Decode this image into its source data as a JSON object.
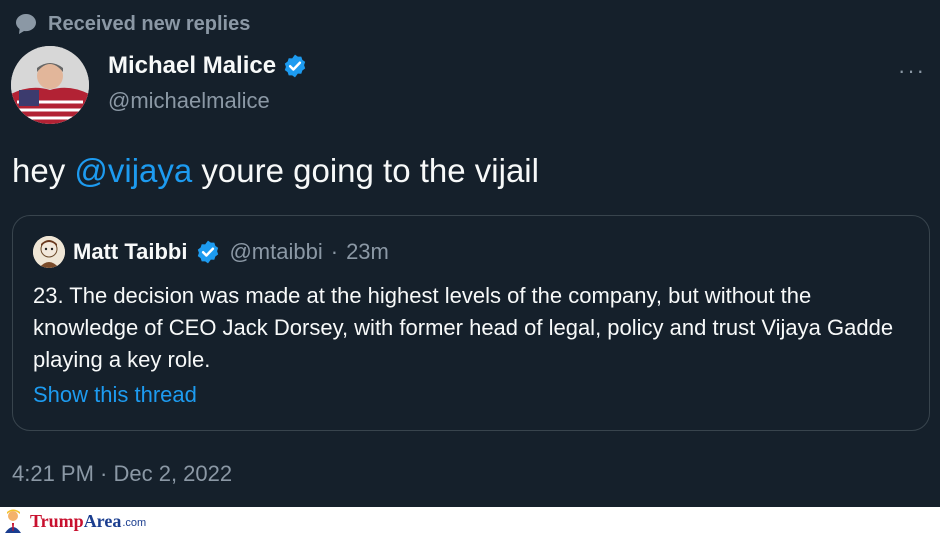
{
  "notice": {
    "text": "Received new replies",
    "icon": "chat-bubble-icon"
  },
  "author": {
    "name": "Michael Malice",
    "handle": "@michaelmalice",
    "verified": true
  },
  "menu": {
    "label": "···"
  },
  "tweet": {
    "prefix": "hey ",
    "mention": "@vijaya",
    "suffix": " youre going to the vijail",
    "timestamp": "4:21 PM · Dec 2, 2022"
  },
  "quote": {
    "name": "Matt Taibbi",
    "handle": "@mtaibbi",
    "separator": "·",
    "time": "23m",
    "body": "23. The decision was made at the highest levels of the company, but without the knowledge of CEO Jack Dorsey, with former head of legal, policy and trust Vijaya Gadde playing a key role.",
    "show_thread": "Show this thread"
  },
  "watermark": {
    "part1": "Trump",
    "part2": "Area",
    "part3": ".com"
  },
  "colors": {
    "background": "#15202b",
    "accent": "#1d9bf0",
    "muted": "#8b98a5",
    "border": "#38444d"
  }
}
